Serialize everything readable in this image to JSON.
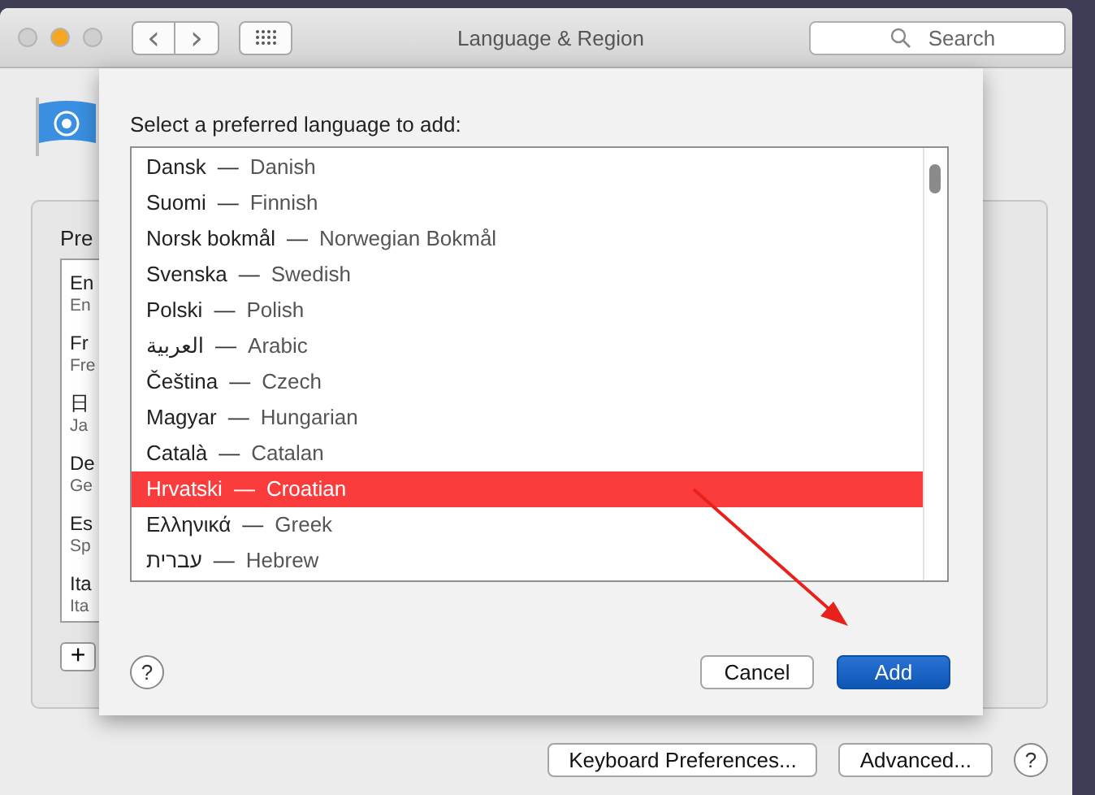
{
  "window": {
    "title": "Language & Region",
    "traffic_lights": [
      {
        "color": "#cfcfcf"
      },
      {
        "color": "#f5a623"
      },
      {
        "color": "#cfcfcf"
      }
    ],
    "nav": [
      "‹",
      "›"
    ],
    "search": {
      "placeholder": "Search"
    }
  },
  "preferred": {
    "label": "Pre",
    "items": [
      {
        "name": "En",
        "sub": "En"
      },
      {
        "name": "Fr",
        "sub": "Fre"
      },
      {
        "name": "日",
        "sub": "Ja"
      },
      {
        "name": "De",
        "sub": "Ge"
      },
      {
        "name": "Es",
        "sub": "Sp"
      },
      {
        "name": "Ita",
        "sub": "Ita"
      }
    ],
    "add_button": "+"
  },
  "bottom_buttons": [
    "Keyboard Preferences...",
    "Advanced..."
  ],
  "help": "?",
  "sheet": {
    "prompt": "Select a preferred language to add:",
    "languages": [
      {
        "native": "Dansk",
        "separator": "—",
        "english": "Danish",
        "selected": false
      },
      {
        "native": "Suomi",
        "separator": "—",
        "english": "Finnish",
        "selected": false
      },
      {
        "native": "Norsk bokmål",
        "separator": "—",
        "english": "Norwegian Bokmål",
        "selected": false
      },
      {
        "native": "Svenska",
        "separator": "—",
        "english": "Swedish",
        "selected": false
      },
      {
        "native": "Polski",
        "separator": "—",
        "english": "Polish",
        "selected": false
      },
      {
        "native": "العربية",
        "separator": "—",
        "english": "Arabic",
        "selected": false
      },
      {
        "native": "Čeština",
        "separator": "—",
        "english": "Czech",
        "selected": false
      },
      {
        "native": "Magyar",
        "separator": "—",
        "english": "Hungarian",
        "selected": false
      },
      {
        "native": "Català",
        "separator": "—",
        "english": "Catalan",
        "selected": false
      },
      {
        "native": "Hrvatski",
        "separator": "—",
        "english": "Croatian",
        "selected": true
      },
      {
        "native": "Ελληνικά",
        "separator": "—",
        "english": "Greek",
        "selected": false
      },
      {
        "native": "עברית",
        "separator": "—",
        "english": "Hebrew",
        "selected": false
      }
    ],
    "help": "?",
    "buttons": [
      {
        "label": "Cancel",
        "kind": "normal"
      },
      {
        "label": "Add",
        "kind": "default"
      }
    ]
  }
}
